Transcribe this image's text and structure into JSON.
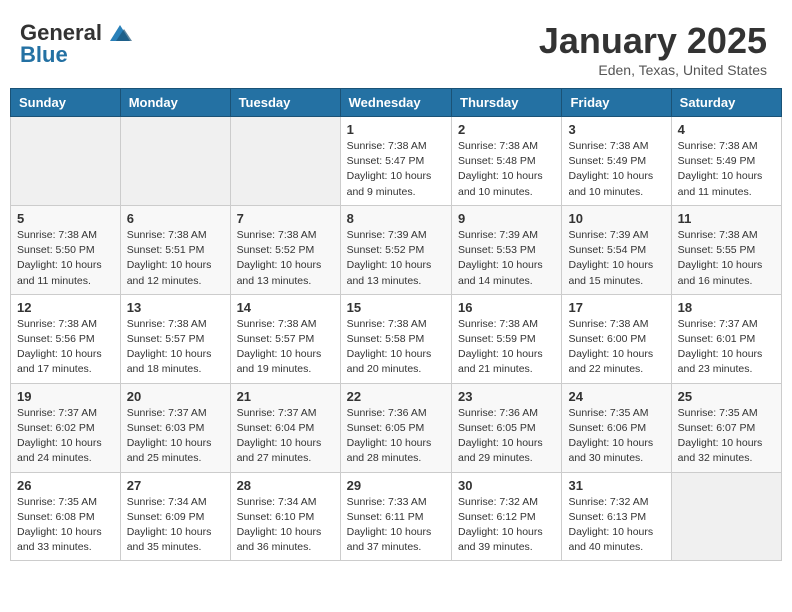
{
  "logo": {
    "general": "General",
    "blue": "Blue"
  },
  "header": {
    "month": "January 2025",
    "location": "Eden, Texas, United States"
  },
  "weekdays": [
    "Sunday",
    "Monday",
    "Tuesday",
    "Wednesday",
    "Thursday",
    "Friday",
    "Saturday"
  ],
  "weeks": [
    [
      {
        "day": "",
        "info": ""
      },
      {
        "day": "",
        "info": ""
      },
      {
        "day": "",
        "info": ""
      },
      {
        "day": "1",
        "info": "Sunrise: 7:38 AM\nSunset: 5:47 PM\nDaylight: 10 hours\nand 9 minutes."
      },
      {
        "day": "2",
        "info": "Sunrise: 7:38 AM\nSunset: 5:48 PM\nDaylight: 10 hours\nand 10 minutes."
      },
      {
        "day": "3",
        "info": "Sunrise: 7:38 AM\nSunset: 5:49 PM\nDaylight: 10 hours\nand 10 minutes."
      },
      {
        "day": "4",
        "info": "Sunrise: 7:38 AM\nSunset: 5:49 PM\nDaylight: 10 hours\nand 11 minutes."
      }
    ],
    [
      {
        "day": "5",
        "info": "Sunrise: 7:38 AM\nSunset: 5:50 PM\nDaylight: 10 hours\nand 11 minutes."
      },
      {
        "day": "6",
        "info": "Sunrise: 7:38 AM\nSunset: 5:51 PM\nDaylight: 10 hours\nand 12 minutes."
      },
      {
        "day": "7",
        "info": "Sunrise: 7:38 AM\nSunset: 5:52 PM\nDaylight: 10 hours\nand 13 minutes."
      },
      {
        "day": "8",
        "info": "Sunrise: 7:39 AM\nSunset: 5:52 PM\nDaylight: 10 hours\nand 13 minutes."
      },
      {
        "day": "9",
        "info": "Sunrise: 7:39 AM\nSunset: 5:53 PM\nDaylight: 10 hours\nand 14 minutes."
      },
      {
        "day": "10",
        "info": "Sunrise: 7:39 AM\nSunset: 5:54 PM\nDaylight: 10 hours\nand 15 minutes."
      },
      {
        "day": "11",
        "info": "Sunrise: 7:38 AM\nSunset: 5:55 PM\nDaylight: 10 hours\nand 16 minutes."
      }
    ],
    [
      {
        "day": "12",
        "info": "Sunrise: 7:38 AM\nSunset: 5:56 PM\nDaylight: 10 hours\nand 17 minutes."
      },
      {
        "day": "13",
        "info": "Sunrise: 7:38 AM\nSunset: 5:57 PM\nDaylight: 10 hours\nand 18 minutes."
      },
      {
        "day": "14",
        "info": "Sunrise: 7:38 AM\nSunset: 5:57 PM\nDaylight: 10 hours\nand 19 minutes."
      },
      {
        "day": "15",
        "info": "Sunrise: 7:38 AM\nSunset: 5:58 PM\nDaylight: 10 hours\nand 20 minutes."
      },
      {
        "day": "16",
        "info": "Sunrise: 7:38 AM\nSunset: 5:59 PM\nDaylight: 10 hours\nand 21 minutes."
      },
      {
        "day": "17",
        "info": "Sunrise: 7:38 AM\nSunset: 6:00 PM\nDaylight: 10 hours\nand 22 minutes."
      },
      {
        "day": "18",
        "info": "Sunrise: 7:37 AM\nSunset: 6:01 PM\nDaylight: 10 hours\nand 23 minutes."
      }
    ],
    [
      {
        "day": "19",
        "info": "Sunrise: 7:37 AM\nSunset: 6:02 PM\nDaylight: 10 hours\nand 24 minutes."
      },
      {
        "day": "20",
        "info": "Sunrise: 7:37 AM\nSunset: 6:03 PM\nDaylight: 10 hours\nand 25 minutes."
      },
      {
        "day": "21",
        "info": "Sunrise: 7:37 AM\nSunset: 6:04 PM\nDaylight: 10 hours\nand 27 minutes."
      },
      {
        "day": "22",
        "info": "Sunrise: 7:36 AM\nSunset: 6:05 PM\nDaylight: 10 hours\nand 28 minutes."
      },
      {
        "day": "23",
        "info": "Sunrise: 7:36 AM\nSunset: 6:05 PM\nDaylight: 10 hours\nand 29 minutes."
      },
      {
        "day": "24",
        "info": "Sunrise: 7:35 AM\nSunset: 6:06 PM\nDaylight: 10 hours\nand 30 minutes."
      },
      {
        "day": "25",
        "info": "Sunrise: 7:35 AM\nSunset: 6:07 PM\nDaylight: 10 hours\nand 32 minutes."
      }
    ],
    [
      {
        "day": "26",
        "info": "Sunrise: 7:35 AM\nSunset: 6:08 PM\nDaylight: 10 hours\nand 33 minutes."
      },
      {
        "day": "27",
        "info": "Sunrise: 7:34 AM\nSunset: 6:09 PM\nDaylight: 10 hours\nand 35 minutes."
      },
      {
        "day": "28",
        "info": "Sunrise: 7:34 AM\nSunset: 6:10 PM\nDaylight: 10 hours\nand 36 minutes."
      },
      {
        "day": "29",
        "info": "Sunrise: 7:33 AM\nSunset: 6:11 PM\nDaylight: 10 hours\nand 37 minutes."
      },
      {
        "day": "30",
        "info": "Sunrise: 7:32 AM\nSunset: 6:12 PM\nDaylight: 10 hours\nand 39 minutes."
      },
      {
        "day": "31",
        "info": "Sunrise: 7:32 AM\nSunset: 6:13 PM\nDaylight: 10 hours\nand 40 minutes."
      },
      {
        "day": "",
        "info": ""
      }
    ]
  ]
}
